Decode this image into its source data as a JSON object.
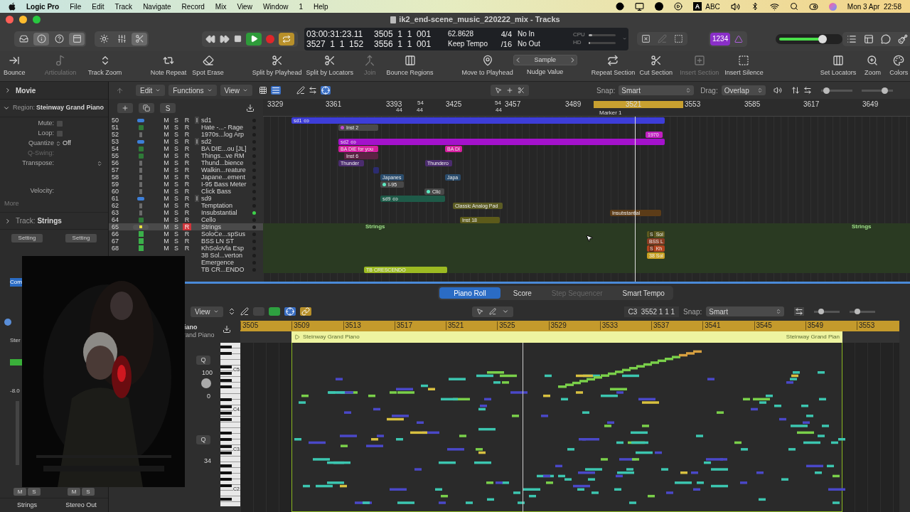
{
  "menubar": {
    "app": "Logic Pro",
    "menus": [
      "File",
      "Edit",
      "Track",
      "Navigate",
      "Record",
      "Mix",
      "View",
      "Window",
      "1",
      "Help"
    ],
    "input_badge": "A",
    "input_source": "ABC",
    "clock": "Mon 3 Apr  22:58"
  },
  "window": {
    "title": "ik2_end-scene_music_220222_mix - Tracks"
  },
  "control_bar": {
    "view_buttons": [
      {
        "selected": false
      },
      {
        "selected": true
      },
      {
        "selected": false
      },
      {
        "selected": true
      }
    ],
    "mode_buttons": [
      {
        "selected": false
      },
      {
        "selected": false
      },
      {
        "selected": true
      }
    ],
    "play_on": true,
    "cycle_on": true,
    "lcd": {
      "rows": [
        [
          "03:00:31:23.11",
          "3505  1  1  001",
          "62.8628",
          "4/4",
          "No In"
        ],
        [
          "3527  1  1  152",
          "3556  1  1  001",
          "Keep Tempo",
          "/16",
          "No Out"
        ]
      ],
      "meters": [
        {
          "label": "CPU",
          "level": 0.12
        },
        {
          "label": "HD",
          "level": 0.05
        }
      ]
    },
    "count_in": {
      "label": "1234",
      "on": true
    },
    "master_volume": {
      "level": 0.72
    }
  },
  "toolbar": [
    {
      "label": "Bounce",
      "disabled": false
    },
    {
      "label": "Articulation",
      "disabled": true
    },
    {
      "label": "Track Zoom",
      "disabled": false
    },
    {
      "label": "Note Repeat",
      "disabled": false
    },
    {
      "label": "Spot Erase",
      "disabled": false
    },
    {
      "label": "Split by Playhead",
      "disabled": false
    },
    {
      "label": "Split by Locators",
      "disabled": false
    },
    {
      "label": "Join",
      "disabled": true
    },
    {
      "label": "Bounce Regions",
      "disabled": false
    },
    {
      "label": "Move to Playhead",
      "disabled": false
    },
    {
      "label": "Repeat Section",
      "disabled": false
    },
    {
      "label": "Cut Section",
      "disabled": false
    },
    {
      "label": "Insert Section",
      "disabled": true
    },
    {
      "label": "Insert Silence",
      "disabled": false
    },
    {
      "label": "Set Locators",
      "disabled": false
    },
    {
      "label": "Zoom",
      "disabled": false
    },
    {
      "label": "Colors",
      "disabled": false
    }
  ],
  "nudge": {
    "value": "Sample",
    "label": "Nudge Value"
  },
  "inspector": {
    "movie": {
      "label": "Movie",
      "expanded": false
    },
    "region": {
      "label": "Region:",
      "name": "Steinway Grand Piano",
      "expanded": true
    },
    "params": [
      {
        "label": "Mute:",
        "kind": "checkbox",
        "checked": false
      },
      {
        "label": "Loop:",
        "kind": "checkbox",
        "checked": false
      },
      {
        "label": "Quantize",
        "kind": "select",
        "value": "Off"
      },
      {
        "label": "Q-Swing:",
        "kind": "disabled"
      },
      {
        "label": "Transpose:",
        "kind": "stepper"
      },
      {
        "label": "Velocity:",
        "kind": "plain"
      }
    ],
    "more": "More",
    "track": {
      "label": "Track:",
      "name": "Strings",
      "expanded": false
    },
    "settings": [
      "Setting",
      "Setting"
    ],
    "cut_texts": [
      "Com",
      "Ster",
      "-8.0"
    ],
    "strips": [
      {
        "name": "Strings",
        "mute": "M",
        "solo": "S"
      },
      {
        "name": "Stereo Out",
        "mute": "M",
        "solo": "S"
      }
    ]
  },
  "tracks_toolbar": {
    "menus": [
      "Edit",
      "Functions",
      "View"
    ],
    "snap_label": "Snap:",
    "snap": "Smart",
    "drag_label": "Drag:",
    "drag": "Overlap",
    "solo_button": "S",
    "zoom_sliders": [
      {
        "level": 0.1
      },
      {
        "level": 0.8
      }
    ]
  },
  "ruler": {
    "ticks": [
      "3329",
      "3361",
      "3393",
      "3425",
      "3457",
      "3489",
      "3521",
      "3553",
      "3585",
      "3617",
      "3649"
    ],
    "marks": [
      "54",
      "54",
      "44",
      "44",
      "44"
    ],
    "cycle": true,
    "marker": "Marker 1"
  },
  "tracks": [
    {
      "number": "50",
      "kind": "audio",
      "mute": "M",
      "solo": "S",
      "rec": "R",
      "input": "I",
      "name": "sd1",
      "selected": false,
      "record": false,
      "active": false,
      "regions": [
        {
          "label": "sd1",
          "color": "#3d3dd8",
          "kind": "loop"
        }
      ]
    },
    {
      "number": "51",
      "kind": "midi",
      "mute": "M",
      "solo": "S",
      "rec": "R",
      "name": "Hate -...- Rage",
      "selected": false,
      "record": false,
      "active": false,
      "regions": [
        {
          "label": "Inst 2",
          "color": "#4a4a4a",
          "kind": "plain",
          "dot": {
            "color": "#c04cc8"
          }
        }
      ]
    },
    {
      "number": "52",
      "kind": "instrument",
      "mute": "M",
      "solo": "S",
      "rec": "R",
      "name": "1970s...log Arp",
      "selected": false,
      "record": false,
      "active": false,
      "regions": [
        {
          "label": "1970",
          "color": "#c21fc2",
          "kind": "plain"
        }
      ]
    },
    {
      "number": "53",
      "kind": "audio",
      "mute": "M",
      "solo": "S",
      "rec": "R",
      "input": "I",
      "name": "sd2",
      "selected": false,
      "record": false,
      "active": false,
      "regions": [
        {
          "label": "sd2",
          "color": "#a412cc",
          "kind": "loop"
        }
      ]
    },
    {
      "number": "54",
      "kind": "midi",
      "mute": "M",
      "solo": "S",
      "rec": "R",
      "name": "BA DIE...ou [JL]",
      "selected": false,
      "record": false,
      "active": false,
      "regions": [
        {
          "label": "BA DIE for you",
          "color": "#d61fa0",
          "kind": "plain"
        },
        {
          "label": "BA DI",
          "color": "#d61fa0",
          "kind": "plain"
        }
      ]
    },
    {
      "number": "55",
      "kind": "midi",
      "mute": "M",
      "solo": "S",
      "rec": "R",
      "name": "Things...ve RM",
      "selected": false,
      "record": false,
      "active": false,
      "regions": [
        {
          "label": "Inst 6",
          "color": "#5c2244",
          "kind": "plain"
        }
      ]
    },
    {
      "number": "56",
      "kind": "instrument",
      "mute": "M",
      "solo": "S",
      "rec": "R",
      "name": "Thund...bience",
      "selected": false,
      "record": false,
      "active": false,
      "regions": [
        {
          "label": "Thunder",
          "color": "#4b2c6e",
          "kind": "plain"
        },
        {
          "label": "Thundero",
          "color": "#4b2c6e",
          "kind": "plain"
        }
      ]
    },
    {
      "number": "57",
      "kind": "instrument",
      "mute": "M",
      "solo": "S",
      "rec": "R",
      "name": "Walkin...reature",
      "selected": false,
      "record": false,
      "active": false,
      "regions": [
        {
          "color": "#2c2c70",
          "kind": "plain"
        }
      ]
    },
    {
      "number": "58",
      "kind": "instrument",
      "mute": "M",
      "solo": "S",
      "rec": "R",
      "name": "Japane...ement",
      "selected": false,
      "record": false,
      "active": false,
      "regions": [
        {
          "label": "Japanes",
          "color": "#2a4c6c",
          "kind": "plain"
        },
        {
          "label": "Japa",
          "color": "#2a4c6c",
          "kind": "plain"
        }
      ]
    },
    {
      "number": "59",
      "kind": "instrument",
      "mute": "M",
      "solo": "S",
      "rec": "R",
      "name": "I-95 Bass Meter",
      "selected": false,
      "record": false,
      "active": false,
      "regions": [
        {
          "label": "I-95",
          "color": "#484848",
          "kind": "plain",
          "dot": {
            "color": "#5ee8c0"
          }
        }
      ]
    },
    {
      "number": "60",
      "kind": "instrument",
      "mute": "M",
      "solo": "S",
      "rec": "R",
      "name": "Click Bass",
      "selected": false,
      "record": false,
      "active": false,
      "regions": [
        {
          "label": "Clic",
          "color": "#484848",
          "kind": "plain",
          "dot": {
            "color": "#5ee8c0"
          }
        }
      ]
    },
    {
      "number": "61",
      "kind": "audio",
      "mute": "M",
      "solo": "S",
      "rec": "R",
      "input": "I",
      "name": "sd9",
      "selected": false,
      "record": false,
      "active": false,
      "regions": [
        {
          "label": "sd9",
          "color": "#1e5a48",
          "kind": "loop"
        }
      ]
    },
    {
      "number": "62",
      "kind": "instrument",
      "mute": "M",
      "solo": "S",
      "rec": "R",
      "name": "Temptation",
      "selected": false,
      "record": false,
      "active": false,
      "regions": [
        {
          "label": "Classic Analog Pad",
          "color": "#5c5c24",
          "kind": "plain"
        }
      ]
    },
    {
      "number": "63",
      "kind": "instrument",
      "mute": "M",
      "solo": "S",
      "rec": "R",
      "name": "Insubstantial",
      "selected": false,
      "record": false,
      "active": true,
      "regions": [
        {
          "label": "Insubstantial",
          "color": "#5c3c18",
          "kind": "plain"
        }
      ]
    },
    {
      "number": "64",
      "kind": "midi",
      "mute": "M",
      "solo": "S",
      "rec": "R",
      "name": "Cello",
      "selected": false,
      "record": false,
      "active": false,
      "regions": [
        {
          "label": "Inst 18",
          "color": "#5c5a1a",
          "kind": "plain"
        }
      ]
    },
    {
      "number": "65",
      "kind": "stack",
      "mute": "M",
      "solo": "S",
      "rec": "R",
      "name": "Strings",
      "selected": true,
      "record": true,
      "active": false,
      "regions": [
        {
          "label": "Strings",
          "kind": "folder_label"
        },
        {
          "label": "Strings",
          "kind": "folder_label"
        }
      ]
    },
    {
      "number": "66",
      "kind": "sub",
      "mute": "M",
      "solo": "S",
      "rec": "R",
      "name": "SoloCe...spSus",
      "selected": false,
      "record": false,
      "active": false,
      "regions": [
        {
          "label": "Sol",
          "tag": "S",
          "color": "#5c5a20",
          "kind": "plain"
        }
      ]
    },
    {
      "number": "67",
      "kind": "sub",
      "mute": "M",
      "solo": "S",
      "rec": "R",
      "name": "BSS LN ST",
      "selected": false,
      "record": false,
      "active": false,
      "regions": [
        {
          "label": "BSS L",
          "color": "#8a3c22",
          "kind": "plain"
        }
      ]
    },
    {
      "number": "68",
      "kind": "sub",
      "mute": "M",
      "solo": "S",
      "rec": "R",
      "name": "KhSoloVla Esp",
      "selected": false,
      "record": false,
      "active": false,
      "regions": [
        {
          "label": "Kh",
          "tag": "S",
          "color": "#b4441e",
          "kind": "plain"
        }
      ]
    },
    {
      "kind": "sub",
      "name": "38 Sol...verton",
      "selected": false,
      "active": false,
      "regions": [
        {
          "label": "38 Sol",
          "color": "#c8a022",
          "kind": "plain"
        }
      ]
    },
    {
      "kind": "sub",
      "name": "Emergence",
      "selected": false,
      "active": false
    },
    {
      "kind": "sub",
      "name": "TB CR...ENDO",
      "selected": false,
      "active": false,
      "regions": [
        {
          "label": "TB CRESCENDO",
          "color": "#9cba22",
          "kind": "plain"
        }
      ]
    }
  ],
  "editor": {
    "tabs": [
      {
        "label": "Piano Roll",
        "selected": true,
        "disabled": false
      },
      {
        "label": "Score",
        "selected": false,
        "disabled": false
      },
      {
        "label": "Step Sequencer",
        "selected": false,
        "disabled": true
      },
      {
        "label": "Smart Tempo",
        "selected": false,
        "disabled": false
      }
    ],
    "view_menu": "View",
    "position": "C3  3552 1 1 1",
    "snap_label": "Snap:",
    "snap": "Smart",
    "zoom_sliders": [
      {
        "level": 0.2
      },
      {
        "level": 0.25
      }
    ],
    "track_name": "iano",
    "track_instrument": "rand Piano",
    "q_buttons": [
      "Q",
      "Q"
    ],
    "values": [
      "100",
      "0",
      "34"
    ],
    "ruler": [
      "3505",
      "3509",
      "3513",
      "3517",
      "3521",
      "3525",
      "3529",
      "3533",
      "3537",
      "3541",
      "3545",
      "3549",
      "3553"
    ],
    "region": "Steinway Grand Piano",
    "region_end": "Steinway Grand Pian",
    "keys": [
      "C5",
      "C4",
      "C3",
      "C2"
    ]
  }
}
